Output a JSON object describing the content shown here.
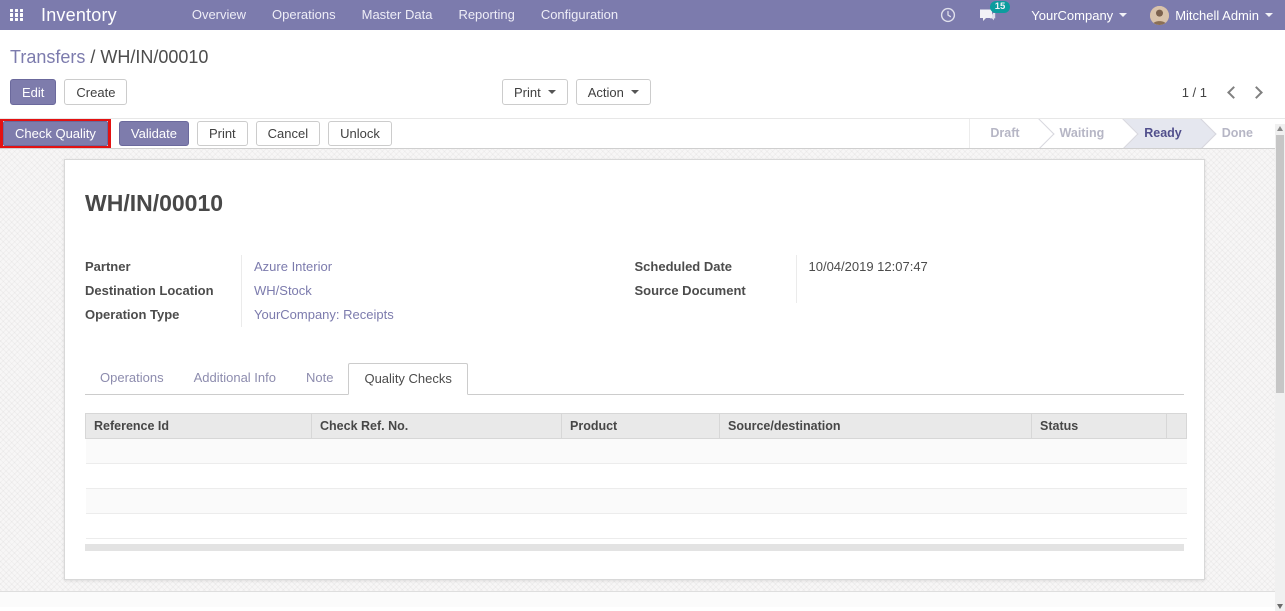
{
  "navbar": {
    "app_title": "Inventory",
    "menu_items": [
      "Overview",
      "Operations",
      "Master Data",
      "Reporting",
      "Configuration"
    ],
    "badge_count": "15",
    "company": "YourCompany",
    "user": "Mitchell Admin"
  },
  "control_panel": {
    "breadcrumb": {
      "parent": "Transfers",
      "separator": " / ",
      "current": "WH/IN/00010"
    },
    "buttons": {
      "edit": "Edit",
      "create": "Create",
      "print": "Print",
      "action": "Action"
    },
    "pager": {
      "value": "1 / 1"
    }
  },
  "statusbar": {
    "buttons": {
      "check_quality": "Check Quality",
      "validate": "Validate",
      "print": "Print",
      "cancel": "Cancel",
      "unlock": "Unlock"
    },
    "states": [
      {
        "label": "Draft",
        "active": false
      },
      {
        "label": "Waiting",
        "active": false
      },
      {
        "label": "Ready",
        "active": true
      },
      {
        "label": "Done",
        "active": false
      }
    ]
  },
  "sheet": {
    "title": "WH/IN/00010",
    "fields_left": [
      {
        "label": "Partner",
        "value": "Azure Interior",
        "is_link": true
      },
      {
        "label": "Destination Location",
        "value": "WH/Stock",
        "is_link": true
      },
      {
        "label": "Operation Type",
        "value": "YourCompany: Receipts",
        "is_link": true
      }
    ],
    "fields_right": [
      {
        "label": "Scheduled Date",
        "value": "10/04/2019 12:07:47",
        "is_link": false
      },
      {
        "label": "Source Document",
        "value": "",
        "is_link": false
      }
    ],
    "tabs": [
      {
        "label": "Operations",
        "active": false
      },
      {
        "label": "Additional Info",
        "active": false
      },
      {
        "label": "Note",
        "active": false
      },
      {
        "label": "Quality Checks",
        "active": true
      }
    ],
    "table": {
      "columns": [
        "Reference Id",
        "Check Ref. No.",
        "Product",
        "Source/destination",
        "Status",
        ""
      ],
      "empty_rows": 4
    }
  },
  "icons": {
    "apps": "grid-of-squares",
    "activities": "clock",
    "messages": "speech-bubbles",
    "carets": "triangle-down",
    "pager": "chevron-left-right"
  },
  "colors": {
    "navbar_bg": "#7c7bad",
    "primary_button": "#7e7cac",
    "link": "#7c7bad",
    "message_badge": "#00a09d",
    "highlight_box": "#e31212",
    "status_active_bg": "#e5e7ef",
    "status_active_text": "#514f8c"
  }
}
